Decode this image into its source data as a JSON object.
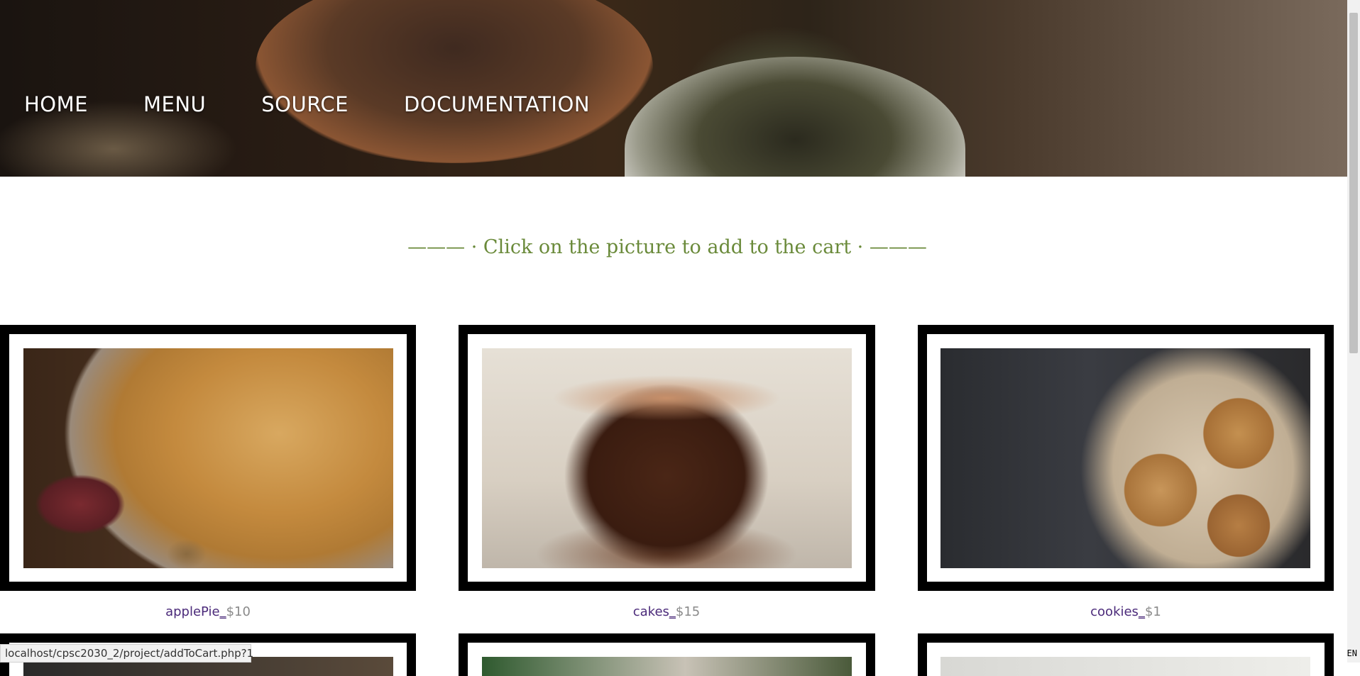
{
  "header": {
    "nav": [
      {
        "label": "HOME"
      },
      {
        "label": "MENU"
      },
      {
        "label": "SOURCE"
      },
      {
        "label": "DOCUMENTATION"
      }
    ]
  },
  "main": {
    "tagline": "——— · Click on the picture to add to the cart · ———",
    "products": [
      {
        "name": "applePie",
        "separator": "_",
        "price": "$10"
      },
      {
        "name": "cakes",
        "separator": "_",
        "price": "$15"
      },
      {
        "name": "cookies",
        "separator": "_",
        "price": "$1"
      }
    ]
  },
  "browser": {
    "status_url": "localhost/cpsc2030_2/project/addToCart.php?1",
    "language": "EN"
  },
  "colors": {
    "tagline": "#6a8a3a",
    "product_name": "#4b2a7a",
    "price": "#8a8a8a"
  }
}
